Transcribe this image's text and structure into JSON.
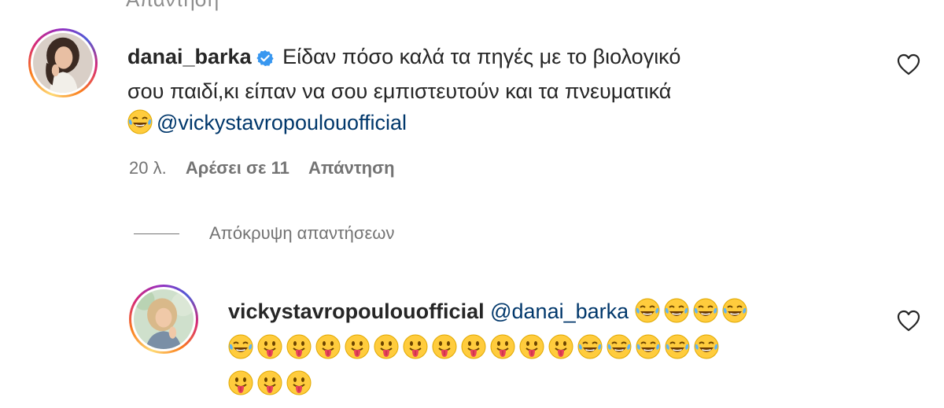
{
  "top_cut_text": "Απάντηση",
  "comment": {
    "username": "danai_barka",
    "text_line1": "Είδαν πόσο καλά τα πηγές με το βιολογικό",
    "text_line2": "σου παιδί,κι είπαν να σου εμπιστευτούν και τα πνευματικά",
    "mention": "@vickystavropoulouofficial",
    "emoji_icon": "face-with-tears-of-joy-icon",
    "time": "20 λ.",
    "likes": "Αρέσει σε 11",
    "reply_label": "Απάντηση"
  },
  "hide_replies_label": "Απόκρυψη απαντήσεων",
  "reply": {
    "username": "vickystavropoulouofficial",
    "mention": "@danai_barka",
    "emoji_lines": [
      [
        "joy",
        "joy",
        "joy",
        "joy"
      ],
      [
        "joy",
        "tongue",
        "tongue",
        "tongue",
        "tongue",
        "tongue",
        "tongue",
        "tongue",
        "tongue",
        "tongue",
        "tongue",
        "tongue",
        "joy",
        "joy",
        "joy",
        "joy",
        "joy"
      ],
      [
        "tongue",
        "tongue",
        "tongue"
      ]
    ],
    "emoji_icons": {
      "joy": "face-with-tears-of-joy-icon",
      "tongue": "face-with-tongue-icon"
    }
  },
  "colors": {
    "accent_mention": "#00376b",
    "verified": "#3897f0",
    "meta": "#737373",
    "text": "#262626"
  }
}
